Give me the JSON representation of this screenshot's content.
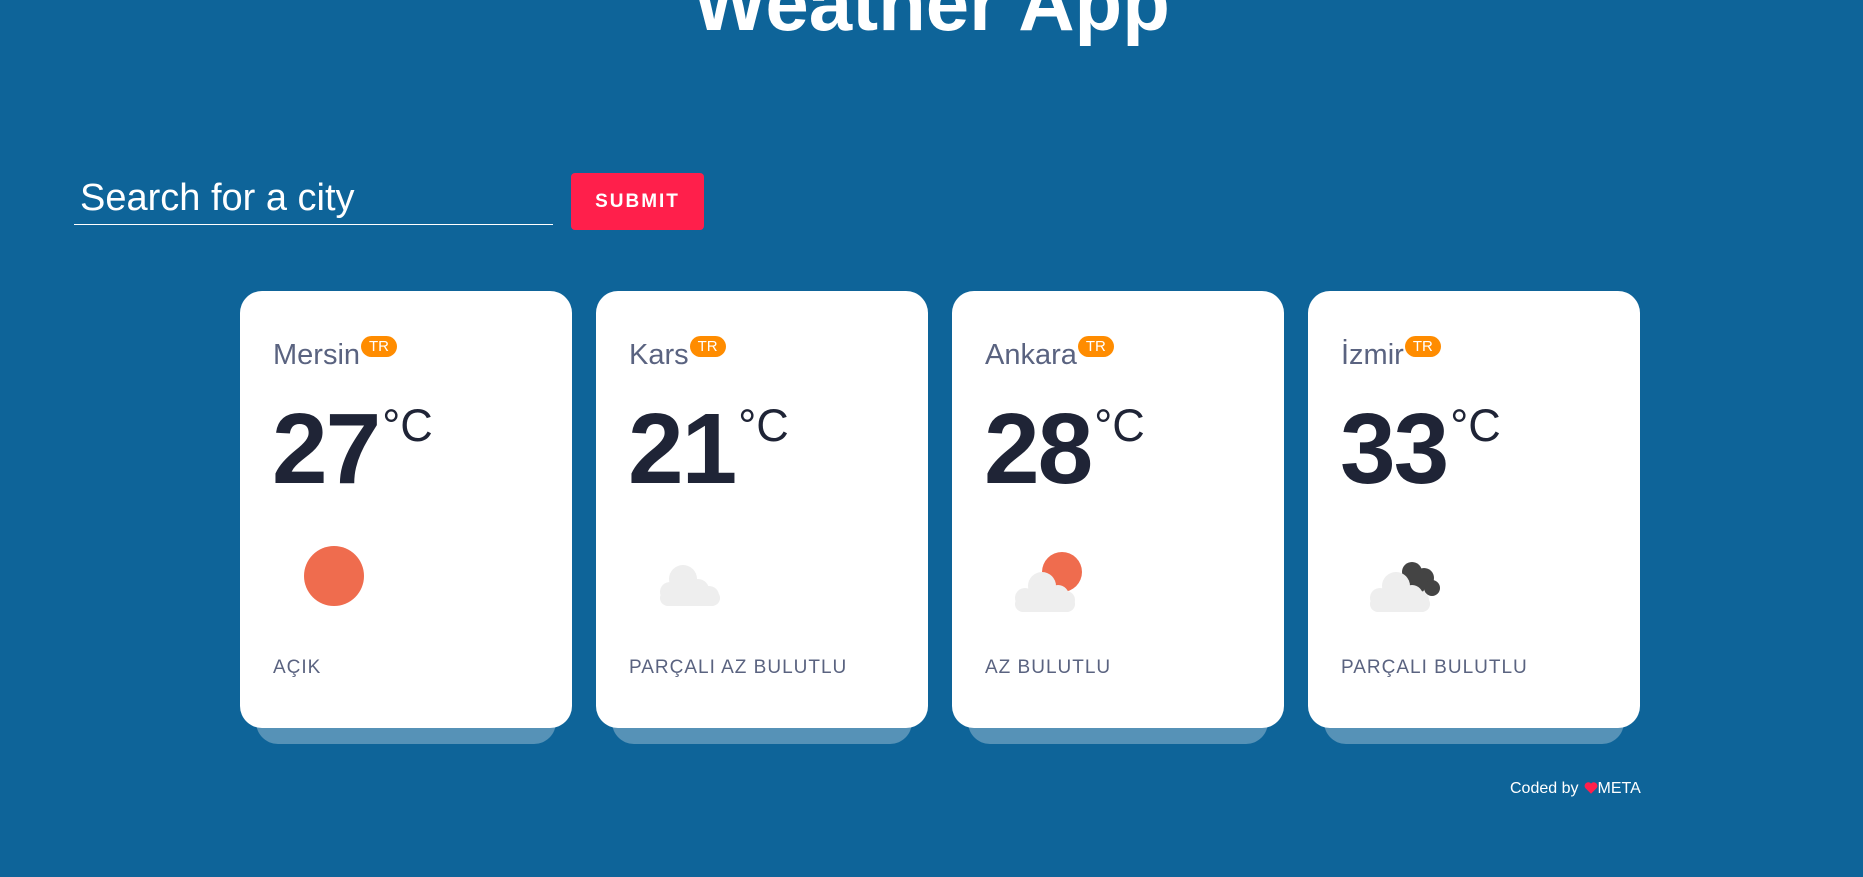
{
  "header": {
    "title": "Weather App"
  },
  "search": {
    "placeholder": "Search for a city",
    "value": "",
    "submit_label": "SUBMIT"
  },
  "cities": [
    {
      "name": "Mersin",
      "country": "TR",
      "temp": "27",
      "unit": "°C",
      "description": "AÇIK",
      "icon": "sun-icon"
    },
    {
      "name": "Kars",
      "country": "TR",
      "temp": "21",
      "unit": "°C",
      "description": "PARÇALI AZ BULUTLU",
      "icon": "cloud-icon"
    },
    {
      "name": "Ankara",
      "country": "TR",
      "temp": "28",
      "unit": "°C",
      "description": "AZ BULUTLU",
      "icon": "sun-behind-cloud-icon"
    },
    {
      "name": "İzmir",
      "country": "TR",
      "temp": "33",
      "unit": "°C",
      "description": "PARÇALI BULUTLU",
      "icon": "broken-clouds-icon"
    }
  ],
  "footer": {
    "prefix": "Coded by",
    "author": "META"
  },
  "colors": {
    "background": "#0e6499",
    "submit_button": "#ff1f4b",
    "badge": "#ff8c00",
    "sun": "#ef6c4e",
    "heart": "#ff1f4b"
  }
}
